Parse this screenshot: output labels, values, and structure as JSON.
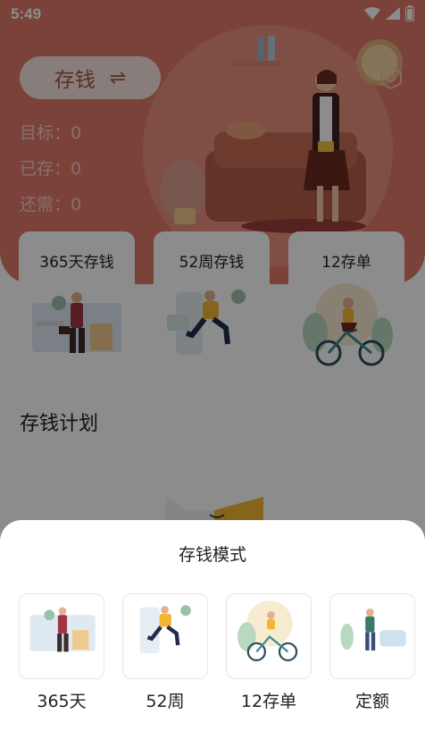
{
  "status_bar": {
    "time": "5:49"
  },
  "header": {
    "mode_button": {
      "label": "存钱",
      "swap_icon": "swap-arrows-icon"
    },
    "stats": [
      {
        "label": "目标：0"
      },
      {
        "label": "已存：0"
      },
      {
        "label": "还需：0"
      }
    ]
  },
  "cards": [
    {
      "title": "365天存钱"
    },
    {
      "title": "52周存钱"
    },
    {
      "title": "12存单"
    }
  ],
  "section": {
    "title": "存钱计划"
  },
  "sheet": {
    "title": "存钱模式",
    "options": [
      {
        "label": "365天"
      },
      {
        "label": "52周"
      },
      {
        "label": "12存单"
      },
      {
        "label": "定额"
      }
    ]
  },
  "colors": {
    "hero": "#e0796a",
    "accent": "#a9544a",
    "dim": "rgba(0,0,0,0.45)"
  }
}
